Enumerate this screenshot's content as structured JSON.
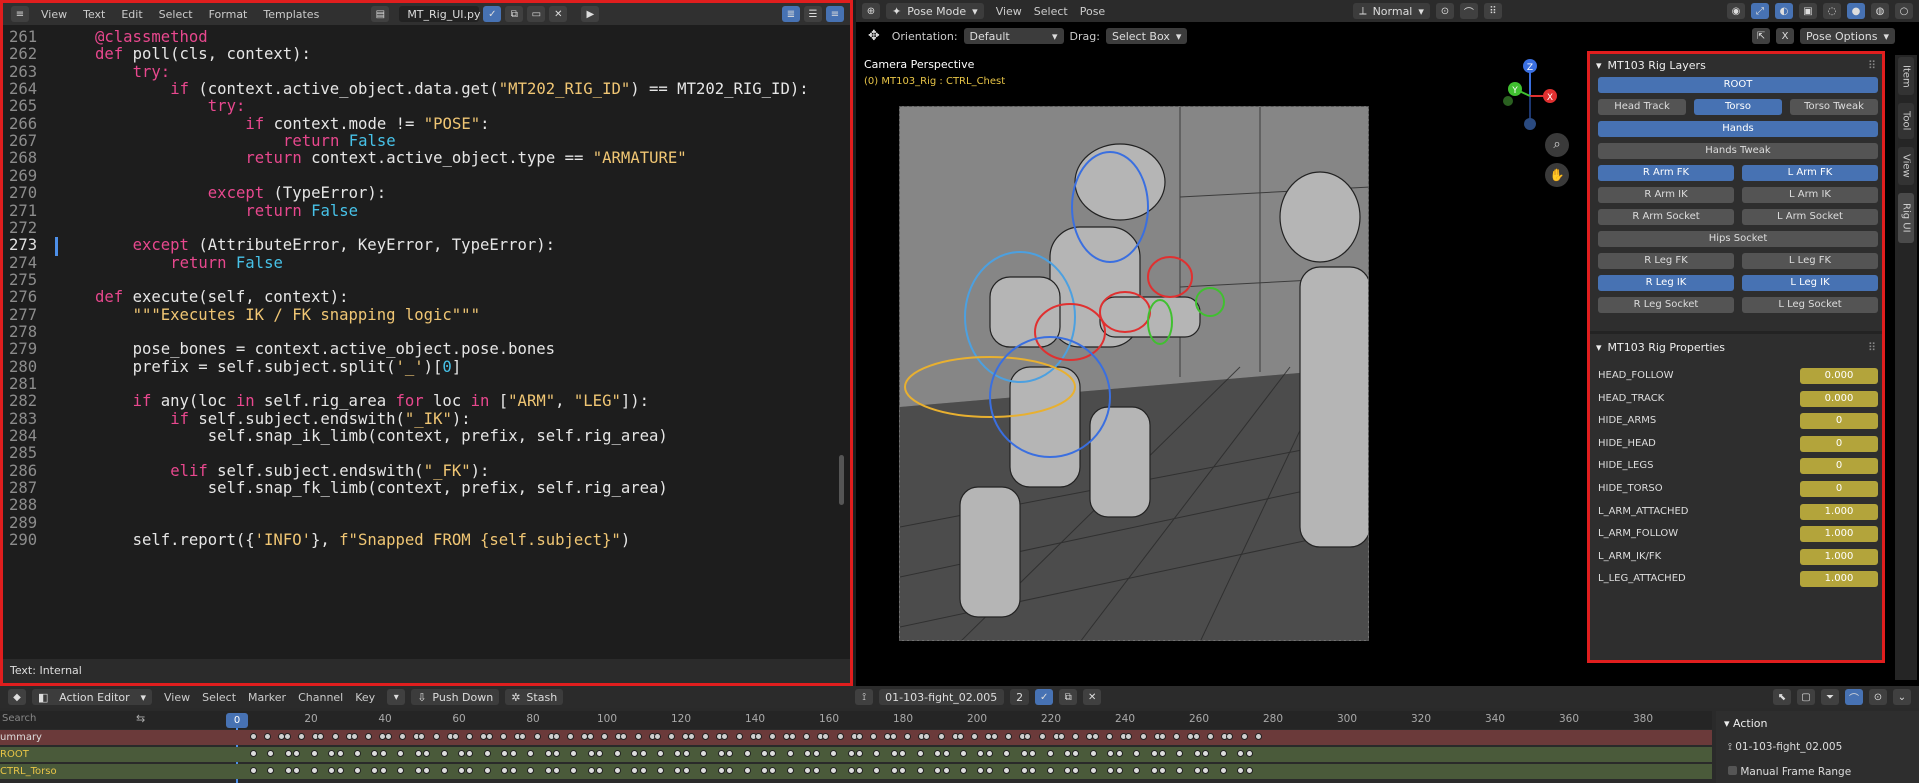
{
  "editor": {
    "menus": [
      "View",
      "Text",
      "Edit",
      "Select",
      "Format",
      "Templates"
    ],
    "filename": "MT_Rig_UI.py",
    "footer": "Text: Internal",
    "current_line": "273",
    "lines": [
      {
        "n": "261",
        "indent": 0,
        "tokens": [
          {
            "t": "@classmethod",
            "c": "deco"
          }
        ]
      },
      {
        "n": "262",
        "indent": 0,
        "tokens": [
          {
            "t": "def ",
            "c": "kw"
          },
          {
            "t": "poll(cls, context):",
            "c": "fn"
          }
        ]
      },
      {
        "n": "263",
        "indent": 1,
        "tokens": [
          {
            "t": "try:",
            "c": "kw"
          }
        ]
      },
      {
        "n": "264",
        "indent": 2,
        "tokens": [
          {
            "t": "if ",
            "c": "kw"
          },
          {
            "t": "(context.active_object.data.get(",
            "c": "fn"
          },
          {
            "t": "\"MT202_RIG_ID\"",
            "c": "str"
          },
          {
            "t": ") == MT202_RIG_ID):",
            "c": "fn"
          }
        ]
      },
      {
        "n": "265",
        "indent": 3,
        "tokens": [
          {
            "t": "try:",
            "c": "kw"
          }
        ]
      },
      {
        "n": "266",
        "indent": 4,
        "tokens": [
          {
            "t": "if ",
            "c": "kw"
          },
          {
            "t": "context.mode != ",
            "c": "fn"
          },
          {
            "t": "\"POSE\"",
            "c": "str"
          },
          {
            "t": ":",
            "c": "fn"
          }
        ]
      },
      {
        "n": "267",
        "indent": 5,
        "tokens": [
          {
            "t": "return ",
            "c": "kw"
          },
          {
            "t": "False",
            "c": "const"
          }
        ]
      },
      {
        "n": "268",
        "indent": 4,
        "tokens": [
          {
            "t": "return ",
            "c": "kw"
          },
          {
            "t": "context.active_object.type == ",
            "c": "fn"
          },
          {
            "t": "\"ARMATURE\"",
            "c": "str"
          }
        ]
      },
      {
        "n": "269",
        "indent": 0,
        "tokens": []
      },
      {
        "n": "270",
        "indent": 3,
        "tokens": [
          {
            "t": "except ",
            "c": "kw"
          },
          {
            "t": "(TypeError):",
            "c": "fn"
          }
        ]
      },
      {
        "n": "271",
        "indent": 4,
        "tokens": [
          {
            "t": "return ",
            "c": "kw"
          },
          {
            "t": "False",
            "c": "const"
          }
        ]
      },
      {
        "n": "272",
        "indent": 0,
        "tokens": []
      },
      {
        "n": "273",
        "indent": 1,
        "tokens": [
          {
            "t": "except ",
            "c": "kw"
          },
          {
            "t": "(AttributeError, KeyError, TypeError):",
            "c": "fn"
          }
        ]
      },
      {
        "n": "274",
        "indent": 2,
        "tokens": [
          {
            "t": "return ",
            "c": "kw"
          },
          {
            "t": "False",
            "c": "const"
          }
        ]
      },
      {
        "n": "275",
        "indent": 0,
        "tokens": []
      },
      {
        "n": "276",
        "indent": 0,
        "tokens": [
          {
            "t": "def ",
            "c": "kw"
          },
          {
            "t": "execute(self, context):",
            "c": "fn"
          }
        ]
      },
      {
        "n": "277",
        "indent": 1,
        "tokens": [
          {
            "t": "\"\"\"Executes IK / FK snapping logic\"\"\"",
            "c": "str"
          }
        ]
      },
      {
        "n": "278",
        "indent": 0,
        "tokens": []
      },
      {
        "n": "279",
        "indent": 1,
        "tokens": [
          {
            "t": "pose_bones = context.active_object.pose.bones",
            "c": "fn"
          }
        ]
      },
      {
        "n": "280",
        "indent": 1,
        "tokens": [
          {
            "t": "prefix = self.subject.split(",
            "c": "fn"
          },
          {
            "t": "'_'",
            "c": "str"
          },
          {
            "t": ")[",
            "c": "fn"
          },
          {
            "t": "0",
            "c": "const"
          },
          {
            "t": "]",
            "c": "fn"
          }
        ]
      },
      {
        "n": "281",
        "indent": 0,
        "tokens": []
      },
      {
        "n": "282",
        "indent": 1,
        "tokens": [
          {
            "t": "if ",
            "c": "kw"
          },
          {
            "t": "any(loc ",
            "c": "fn"
          },
          {
            "t": "in ",
            "c": "kw"
          },
          {
            "t": "self.rig_area ",
            "c": "fn"
          },
          {
            "t": "for ",
            "c": "kw"
          },
          {
            "t": "loc ",
            "c": "fn"
          },
          {
            "t": "in ",
            "c": "kw"
          },
          {
            "t": "[",
            "c": "fn"
          },
          {
            "t": "\"ARM\"",
            "c": "str"
          },
          {
            "t": ", ",
            "c": "fn"
          },
          {
            "t": "\"LEG\"",
            "c": "str"
          },
          {
            "t": "]):",
            "c": "fn"
          }
        ]
      },
      {
        "n": "283",
        "indent": 2,
        "tokens": [
          {
            "t": "if ",
            "c": "kw"
          },
          {
            "t": "self.subject.endswith(",
            "c": "fn"
          },
          {
            "t": "\"_IK\"",
            "c": "str"
          },
          {
            "t": "):",
            "c": "fn"
          }
        ]
      },
      {
        "n": "284",
        "indent": 3,
        "tokens": [
          {
            "t": "self.snap_ik_limb(context, prefix, self.rig_area)",
            "c": "fn"
          }
        ]
      },
      {
        "n": "285",
        "indent": 0,
        "tokens": []
      },
      {
        "n": "286",
        "indent": 2,
        "tokens": [
          {
            "t": "elif ",
            "c": "kw"
          },
          {
            "t": "self.subject.endswith(",
            "c": "fn"
          },
          {
            "t": "\"_FK\"",
            "c": "str"
          },
          {
            "t": "):",
            "c": "fn"
          }
        ]
      },
      {
        "n": "287",
        "indent": 3,
        "tokens": [
          {
            "t": "self.snap_fk_limb(context, prefix, self.rig_area)",
            "c": "fn"
          }
        ]
      },
      {
        "n": "288",
        "indent": 0,
        "tokens": []
      },
      {
        "n": "289",
        "indent": 0,
        "tokens": []
      },
      {
        "n": "290",
        "indent": 1,
        "tokens": [
          {
            "t": "self.report({",
            "c": "fn"
          },
          {
            "t": "'INFO'",
            "c": "str"
          },
          {
            "t": "}, ",
            "c": "fn"
          },
          {
            "t": "f\"Snapped FROM {self.subject}\"",
            "c": "str"
          },
          {
            "t": ")",
            "c": "fn"
          }
        ]
      }
    ]
  },
  "viewport": {
    "mode": "Pose Mode",
    "menus": [
      "View",
      "Select",
      "Pose"
    ],
    "transform_orientation": "Normal",
    "orientation_label": "Orientation:",
    "orientation_value": "Default",
    "drag_label": "Drag:",
    "drag_value": "Select Box",
    "pose_options": "Pose Options",
    "camera_label": "Camera Perspective",
    "object_label": "(0) MT103_Rig : CTRL_Chest",
    "gizmo_labels": [
      "Z",
      "Y",
      "X"
    ]
  },
  "side_tabs": [
    "Item",
    "Tool",
    "View",
    "Rig UI"
  ],
  "rig_layers": {
    "title": "MT103 Rig Layers",
    "rows": [
      [
        {
          "label": "ROOT",
          "on": true
        }
      ],
      [
        {
          "label": "Head Track",
          "on": false
        },
        {
          "label": "Torso",
          "on": true
        },
        {
          "label": "Torso Tweak",
          "on": false
        }
      ],
      [
        {
          "label": "Hands",
          "on": true
        }
      ],
      [
        {
          "label": "Hands Tweak",
          "on": false
        }
      ],
      [
        {
          "label": "R Arm FK",
          "on": true
        },
        {
          "label": "L Arm FK",
          "on": true
        }
      ],
      [
        {
          "label": "R Arm IK",
          "on": false
        },
        {
          "label": "L Arm IK",
          "on": false
        }
      ],
      [
        {
          "label": "R Arm Socket",
          "on": false
        },
        {
          "label": "L Arm Socket",
          "on": false
        }
      ],
      [
        {
          "label": "Hips Socket",
          "on": false
        }
      ],
      [
        {
          "label": "R Leg FK",
          "on": false
        },
        {
          "label": "L Leg FK",
          "on": false
        }
      ],
      [
        {
          "label": "R Leg IK",
          "on": true
        },
        {
          "label": "L Leg IK",
          "on": true
        }
      ],
      [
        {
          "label": "R Leg Socket",
          "on": false
        },
        {
          "label": "L Leg Socket",
          "on": false
        }
      ]
    ]
  },
  "rig_properties": {
    "title": "MT103 Rig Properties",
    "items": [
      {
        "name": "HEAD_FOLLOW",
        "value": "0.000"
      },
      {
        "name": "HEAD_TRACK",
        "value": "0.000"
      },
      {
        "name": "HIDE_ARMS",
        "value": "0"
      },
      {
        "name": "HIDE_HEAD",
        "value": "0"
      },
      {
        "name": "HIDE_LEGS",
        "value": "0"
      },
      {
        "name": "HIDE_TORSO",
        "value": "0"
      },
      {
        "name": "L_ARM_ATTACHED",
        "value": "1.000"
      },
      {
        "name": "L_ARM_FOLLOW",
        "value": "1.000"
      },
      {
        "name": "L_ARM_IK/FK",
        "value": "1.000"
      },
      {
        "name": "L_LEG_ATTACHED",
        "value": "1.000"
      }
    ]
  },
  "dopesheet": {
    "editor_type": "Action Editor",
    "menus": [
      "View",
      "Select",
      "Marker",
      "Channel",
      "Key"
    ],
    "push_down": "Push Down",
    "stash": "Stash",
    "action_name": "01-103-fight_02.005",
    "users": "2",
    "search_placeholder": "Search",
    "current_frame": "0",
    "ruler_ticks": [
      "20",
      "40",
      "60",
      "80",
      "100",
      "120",
      "140",
      "160",
      "180",
      "200",
      "220",
      "240",
      "260",
      "280",
      "300",
      "320",
      "340",
      "360",
      "380"
    ],
    "channels": [
      {
        "label": "ummary",
        "kind": "summary"
      },
      {
        "label": "ROOT",
        "kind": "bone"
      },
      {
        "label": "CTRL_Torso",
        "kind": "bone"
      }
    ],
    "action_panel": {
      "title": "Action",
      "name": "01-103-fight_02.005",
      "manual_frame_range": "Manual Frame Range"
    }
  }
}
